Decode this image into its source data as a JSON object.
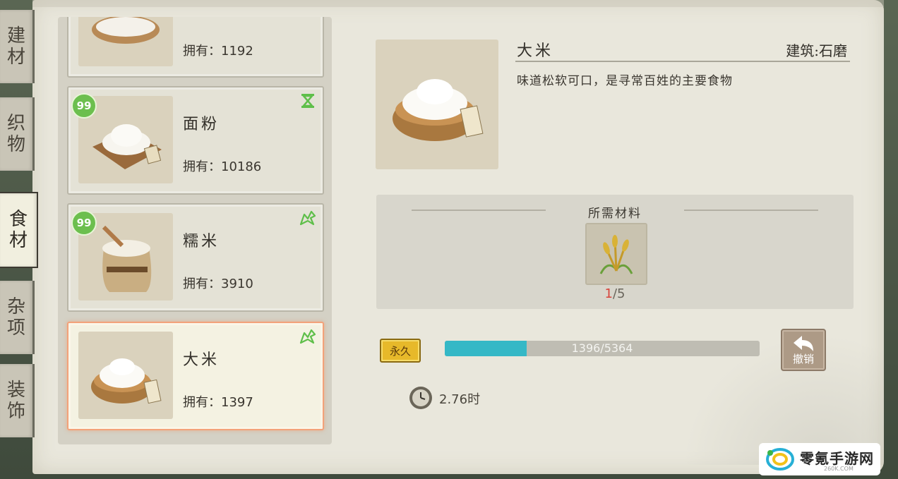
{
  "tabs": [
    {
      "label": "建材",
      "chars": [
        "建",
        "材"
      ],
      "active": false
    },
    {
      "label": "织物",
      "chars": [
        "织",
        "物"
      ],
      "active": false
    },
    {
      "label": "食材",
      "chars": [
        "食",
        "材"
      ],
      "active": true
    },
    {
      "label": "杂项",
      "chars": [
        "杂",
        "项"
      ],
      "active": false
    },
    {
      "label": "装饰",
      "chars": [
        "装",
        "饰"
      ],
      "active": false
    }
  ],
  "items": [
    {
      "name": "",
      "owned": "拥有：1192",
      "badge": "",
      "status_icon": "",
      "selected": false
    },
    {
      "name": "面粉",
      "owned": "拥有：10186",
      "badge": "99",
      "status_icon": "hourglass-icon",
      "selected": false
    },
    {
      "name": "糯米",
      "owned": "拥有：3910",
      "badge": "99",
      "status_icon": "ribbon-icon",
      "selected": false
    },
    {
      "name": "大米",
      "owned": "拥有：1397",
      "badge": "",
      "status_icon": "ribbon-icon",
      "selected": true
    }
  ],
  "detail": {
    "title": "大米",
    "building": "建筑:石磨",
    "description": "味道松软可口，是寻常百姓的主要食物"
  },
  "requirements": {
    "title": "所需材料",
    "item_icon": "wheat-icon",
    "have": "1",
    "need": "/5"
  },
  "progress": {
    "badge_label": "永久",
    "text": "1396/5364",
    "current": 1396,
    "total": 5364
  },
  "undo_button": {
    "label": "撤销"
  },
  "timer": {
    "text": "2.76时"
  },
  "watermark": {
    "title": "零氪手游网",
    "sub": "260K.COM"
  },
  "colors": {
    "progress_fill": "#35b8c6",
    "selected_border": "#f3a27a",
    "badge_green": "#6cbf4e",
    "gold": "#e7b92a"
  }
}
